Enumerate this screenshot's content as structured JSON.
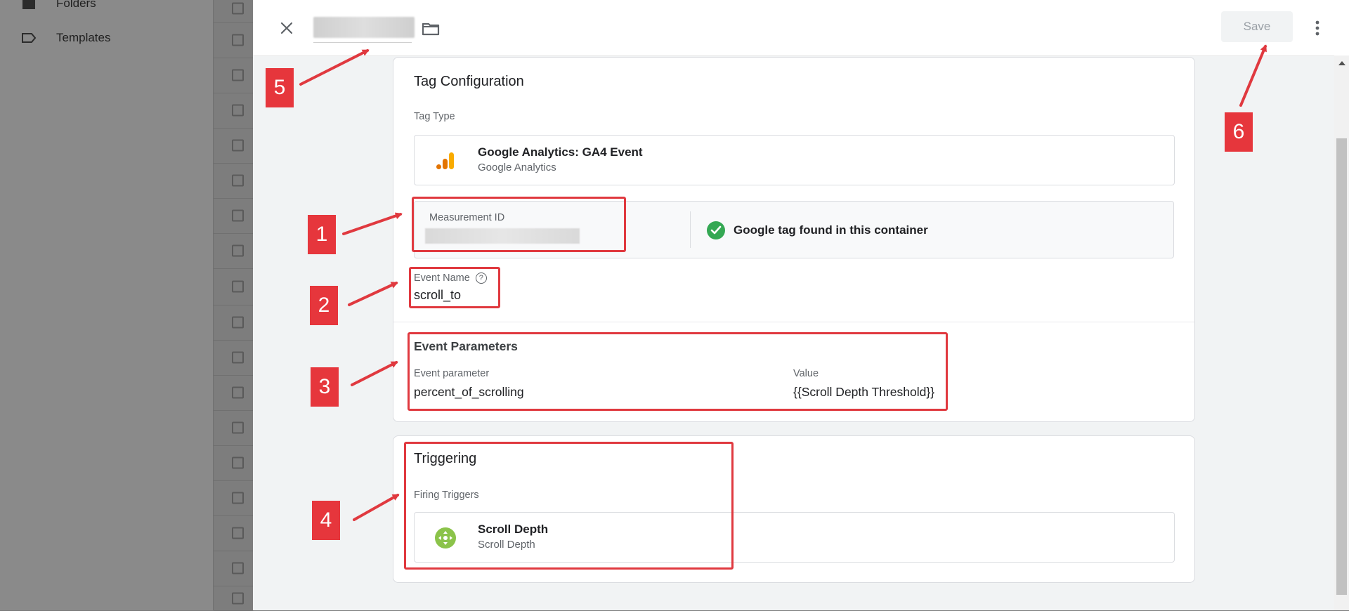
{
  "sidebar": {
    "items": [
      {
        "label": "Folders",
        "icon": "folder-icon"
      },
      {
        "label": "Templates",
        "icon": "label-icon"
      }
    ]
  },
  "editor": {
    "save_label": "Save",
    "tag_configuration": {
      "title": "Tag Configuration",
      "tag_type_label": "Tag Type",
      "tag_type_name": "Google Analytics: GA4 Event",
      "tag_type_sub": "Google Analytics",
      "measurement_id_label": "Measurement ID",
      "google_tag_status": "Google tag found in this container",
      "event_name_label": "Event Name",
      "event_name_value": "scroll_to",
      "event_parameters_title": "Event Parameters",
      "event_parameter_header": "Event parameter",
      "value_header": "Value",
      "parameter_name": "percent_of_scrolling",
      "parameter_value": "{{Scroll Depth Threshold}}"
    },
    "triggering": {
      "title": "Triggering",
      "firing_triggers_label": "Firing Triggers",
      "trigger_name": "Scroll Depth",
      "trigger_sub": "Scroll Depth"
    }
  },
  "annotations": {
    "badges": [
      "1",
      "2",
      "3",
      "4",
      "5",
      "6"
    ],
    "color": "#e6363c"
  },
  "colors": {
    "analytics_orange": "#f9ab00",
    "analytics_dark_orange": "#e37400",
    "trigger_green": "#8bc34a",
    "check_green": "#34a853"
  }
}
